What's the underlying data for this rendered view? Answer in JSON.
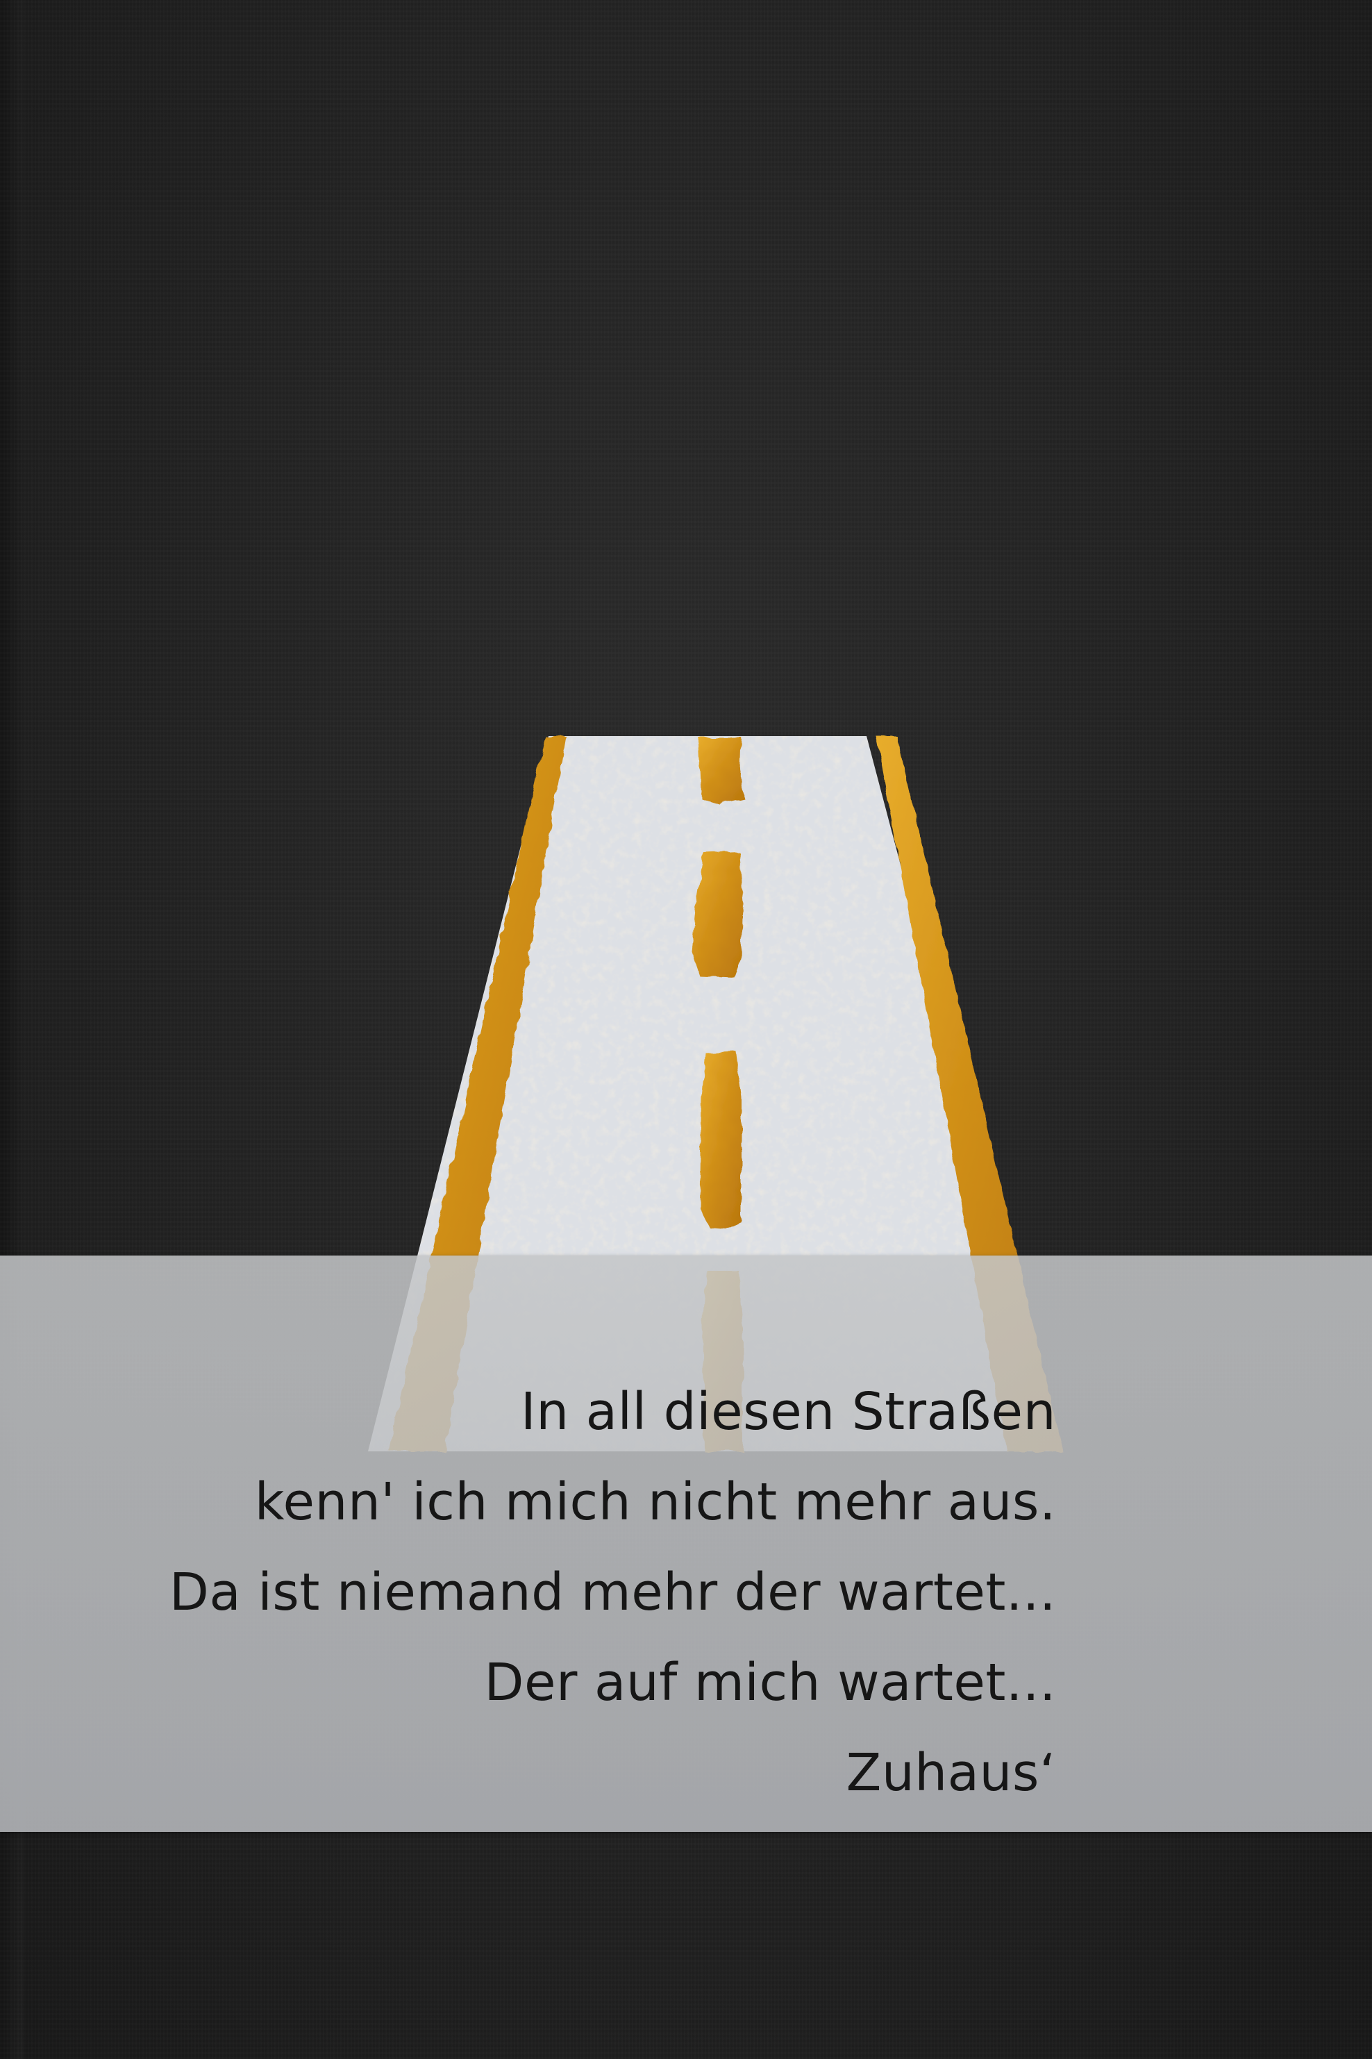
{
  "poem": {
    "lines": [
      "In all diesen Straßen",
      "kenn' ich mich nicht mehr aus.",
      "Da ist niemand mehr der wartet...",
      "Der auf mich wartet...",
      "Zuhaus‘"
    ]
  },
  "colors": {
    "card": "#222222",
    "road": "#dcdfe3",
    "gold": "#d79a1e",
    "vellum": "#bfc1c4",
    "text": "#161616"
  }
}
